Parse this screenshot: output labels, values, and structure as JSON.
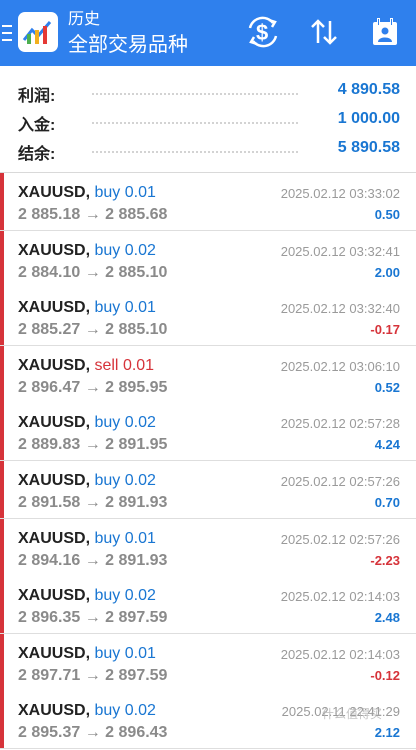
{
  "header": {
    "subtitle": "历史",
    "title": "全部交易品种",
    "bg_color": "#2f80ed"
  },
  "summary": [
    {
      "label": "利润:",
      "value": "4 890.58"
    },
    {
      "label": "入金:",
      "value": "1 000.00"
    },
    {
      "label": "结余:",
      "value": "5 890.58"
    }
  ],
  "trades": [
    {
      "symbol": "XAUUSD,",
      "side": "buy",
      "volume": "0.01",
      "prices": "2 885.18 → 2 885.68",
      "time": "2025.02.12 03:33:02",
      "profit": "0.50",
      "type": "buy",
      "sign": "pos"
    },
    {
      "symbol": "XAUUSD,",
      "side": "buy",
      "volume": "0.02",
      "prices": "2 884.10 → 2 885.10",
      "time": "2025.02.12 03:32:41",
      "profit": "2.00",
      "type": "buy",
      "sign": "pos"
    },
    {
      "symbol": "XAUUSD,",
      "side": "buy",
      "volume": "0.01",
      "prices": "2 885.27 → 2 885.10",
      "time": "2025.02.12 03:32:40",
      "profit": "-0.17",
      "type": "buy",
      "sign": "neg"
    },
    {
      "symbol": "XAUUSD,",
      "side": "sell",
      "volume": "0.01",
      "prices": "2 896.47 → 2 895.95",
      "time": "2025.02.12 03:06:10",
      "profit": "0.52",
      "type": "sell",
      "sign": "pos"
    },
    {
      "symbol": "XAUUSD,",
      "side": "buy",
      "volume": "0.02",
      "prices": "2 889.83 → 2 891.95",
      "time": "2025.02.12 02:57:28",
      "profit": "4.24",
      "type": "buy",
      "sign": "pos"
    },
    {
      "symbol": "XAUUSD,",
      "side": "buy",
      "volume": "0.02",
      "prices": "2 891.58 → 2 891.93",
      "time": "2025.02.12 02:57:26",
      "profit": "0.70",
      "type": "buy",
      "sign": "pos"
    },
    {
      "symbol": "XAUUSD,",
      "side": "buy",
      "volume": "0.01",
      "prices": "2 894.16 → 2 891.93",
      "time": "2025.02.12 02:57:26",
      "profit": "-2.23",
      "type": "buy",
      "sign": "neg"
    },
    {
      "symbol": "XAUUSD,",
      "side": "buy",
      "volume": "0.02",
      "prices": "2 896.35 → 2 897.59",
      "time": "2025.02.12 02:14:03",
      "profit": "2.48",
      "type": "buy",
      "sign": "pos"
    },
    {
      "symbol": "XAUUSD,",
      "side": "buy",
      "volume": "0.01",
      "prices": "2 897.71 → 2 897.59",
      "time": "2025.02.12 02:14:03",
      "profit": "-0.12",
      "type": "buy",
      "sign": "neg"
    },
    {
      "symbol": "XAUUSD,",
      "side": "buy",
      "volume": "0.02",
      "prices": "2 895.37 → 2 896.43",
      "time": "2025.02.11 22:41:29",
      "profit": "2.12",
      "type": "buy",
      "sign": "pos"
    }
  ],
  "watermark": "什么值得买",
  "icons": [
    "menu-icon",
    "app-logo-icon",
    "currency-filter-icon",
    "sort-icon",
    "calendar-icon"
  ]
}
